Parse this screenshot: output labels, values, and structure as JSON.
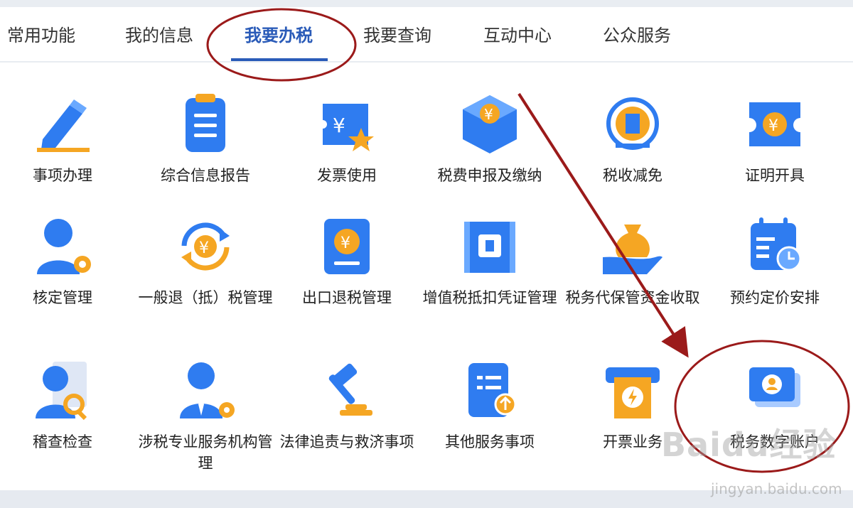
{
  "tabs": [
    {
      "label": "常用功能"
    },
    {
      "label": "我的信息"
    },
    {
      "label": "我要办税",
      "active": true
    },
    {
      "label": "我要查询"
    },
    {
      "label": "互动中心"
    },
    {
      "label": "公众服务"
    }
  ],
  "services": [
    {
      "label": "事项办理",
      "icon": "pen-icon"
    },
    {
      "label": "综合信息报告",
      "icon": "clipboard-list-icon"
    },
    {
      "label": "发票使用",
      "icon": "invoice-star-icon"
    },
    {
      "label": "税费申报及缴纳",
      "icon": "yuan-cube-icon"
    },
    {
      "label": "税收减免",
      "icon": "tax-emblem-icon"
    },
    {
      "label": "证明开具",
      "icon": "ticket-yuan-icon"
    },
    {
      "label": "核定管理",
      "icon": "user-gear-icon"
    },
    {
      "label": "一般退（抵）税管理",
      "icon": "refund-cycle-icon"
    },
    {
      "label": "出口退税管理",
      "icon": "yuan-book-icon"
    },
    {
      "label": "增值税抵扣凭证管理",
      "icon": "vat-ticket-icon"
    },
    {
      "label": "税务代保管资金收取",
      "icon": "money-bag-hand-icon"
    },
    {
      "label": "预约定价安排",
      "icon": "calendar-clock-icon"
    },
    {
      "label": "稽查检查",
      "icon": "inspector-magnifier-icon"
    },
    {
      "label": "涉税专业服务机构管理",
      "icon": "agent-gear-icon"
    },
    {
      "label": "法律追责与救济事项",
      "icon": "gavel-icon"
    },
    {
      "label": "其他服务事项",
      "icon": "document-upload-icon"
    },
    {
      "label": "开票业务",
      "icon": "receipt-printer-icon"
    },
    {
      "label": "税务数字账户",
      "icon": "digital-account-icon"
    }
  ],
  "watermark": {
    "brand": "Baidu经验",
    "url": "jingyan.baidu.com"
  },
  "colors": {
    "accent": "#2a5bb8",
    "icon_blue": "#2f7cf0",
    "icon_orange": "#f5a623",
    "annotation_red": "#9b1a1a"
  }
}
